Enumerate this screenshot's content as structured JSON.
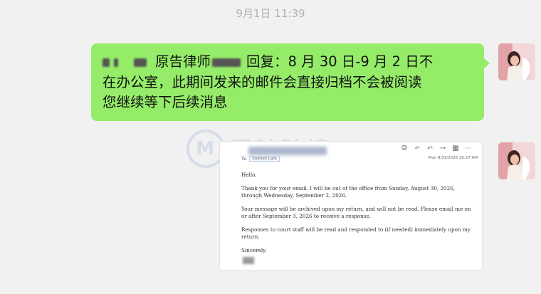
{
  "timestamp": "9月1日 11:39",
  "message": {
    "line1_prefix": "原告律师",
    "line1_suffix": "回复：8 月 30 日-9 月 2 日不",
    "line2": "在办公室，此期间发来的邮件会直接归档不会被阅读",
    "line3": "您继续等下后续消息"
  },
  "email": {
    "to_label": "To",
    "to_value": "Samuel Lam",
    "date": "Mon 8/31/2026 10:27 AM",
    "greeting": "Hello,",
    "para1": "Thank you for your email. I will be out of the office from Sunday, August 30, 2026, through Wednesday, September 2, 2026.",
    "para2": "Your message will be archived upon my return, and will not be read. Please email me on or after September 3, 2026 to receive a response.",
    "para3": "Responses to court staff will be read and responded to (if needed) immediately upon my return.",
    "closing": "Sincerely,"
  },
  "watermark": {
    "text": "黑鲸跨境"
  },
  "colors": {
    "background": "#f1f1f1",
    "bubble": "#95ec69"
  }
}
